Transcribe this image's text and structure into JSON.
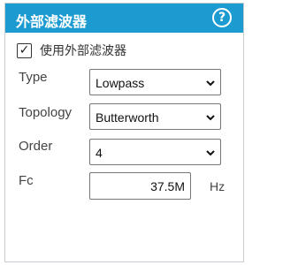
{
  "header": {
    "title": "外部滤波器",
    "help_icon": "help-circle-icon",
    "help_glyph": "?",
    "background": "#1c9bd1"
  },
  "enable": {
    "checked": true,
    "check_glyph": "✓",
    "label": "使用外部滤波器"
  },
  "fields": {
    "type": {
      "label": "Type",
      "value": "Lowpass"
    },
    "topology": {
      "label": "Topology",
      "value": "Butterworth"
    },
    "order": {
      "label": "Order",
      "value": "4"
    },
    "fc": {
      "label": "Fc",
      "value": "37.5M",
      "unit": "Hz"
    }
  }
}
